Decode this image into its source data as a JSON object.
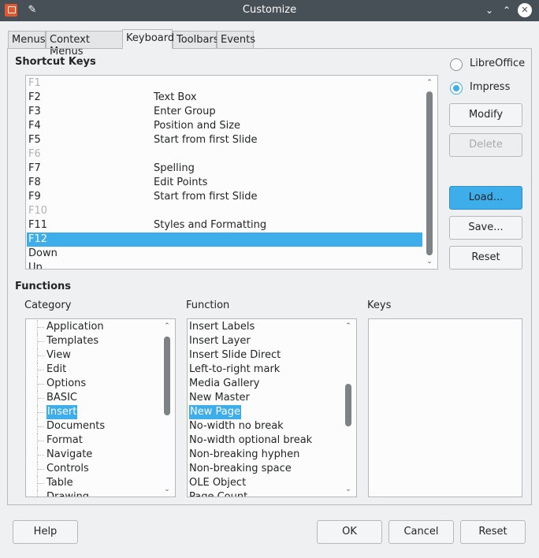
{
  "window": {
    "title": "Customize",
    "app_icon": "impress-icon",
    "pin_icon": "pin-icon",
    "controls": [
      "minimize-icon",
      "maximize-icon",
      "close-icon"
    ]
  },
  "tabs": [
    {
      "label": "Menus",
      "active": false
    },
    {
      "label": "Context Menus",
      "active": false
    },
    {
      "label": "Keyboard",
      "active": true
    },
    {
      "label": "Toolbars",
      "active": false
    },
    {
      "label": "Events",
      "active": false
    }
  ],
  "shortcut_keys": {
    "title": "Shortcut Keys",
    "rows": [
      {
        "key": "F1",
        "command": "",
        "dim": true
      },
      {
        "key": "F2",
        "command": "Text Box",
        "dim": false
      },
      {
        "key": "F3",
        "command": "Enter Group",
        "dim": false
      },
      {
        "key": "F4",
        "command": "Position and Size",
        "dim": false
      },
      {
        "key": "F5",
        "command": "Start from first Slide",
        "dim": false
      },
      {
        "key": "F6",
        "command": "",
        "dim": true
      },
      {
        "key": "F7",
        "command": "Spelling",
        "dim": false
      },
      {
        "key": "F8",
        "command": "Edit Points",
        "dim": false
      },
      {
        "key": "F9",
        "command": "Start from first Slide",
        "dim": false
      },
      {
        "key": "F10",
        "command": "",
        "dim": true
      },
      {
        "key": "F11",
        "command": "Styles and Formatting",
        "dim": false
      },
      {
        "key": "F12",
        "command": "",
        "dim": false,
        "selected": true
      },
      {
        "key": "Down",
        "command": "",
        "dim": false
      },
      {
        "key": "Up",
        "command": "",
        "dim": false
      }
    ]
  },
  "scope": {
    "libreoffice_label": "LibreOffice",
    "impress_label": "Impress",
    "selected": "Impress"
  },
  "buttons": {
    "modify": "Modify",
    "delete": "Delete",
    "load": "Load...",
    "save": "Save...",
    "reset_side": "Reset",
    "help": "Help",
    "ok": "OK",
    "cancel": "Cancel",
    "reset_bottom": "Reset"
  },
  "functions": {
    "title": "Functions",
    "category_label": "Category",
    "function_label": "Function",
    "keys_label": "Keys",
    "categories": [
      "Application",
      "Templates",
      "View",
      "Edit",
      "Options",
      "BASIC",
      "Insert",
      "Documents",
      "Format",
      "Navigate",
      "Controls",
      "Table",
      "Drawing"
    ],
    "selected_category": "Insert",
    "function_list": [
      "Insert Labels",
      "Insert Layer",
      "Insert Slide Direct",
      "Left-to-right mark",
      "Media Gallery",
      "New Master",
      "New Page",
      "No-width no break",
      "No-width optional break",
      "Non-breaking hyphen",
      "Non-breaking space",
      "OLE Object",
      "Page Count"
    ],
    "selected_function": "New Page"
  }
}
